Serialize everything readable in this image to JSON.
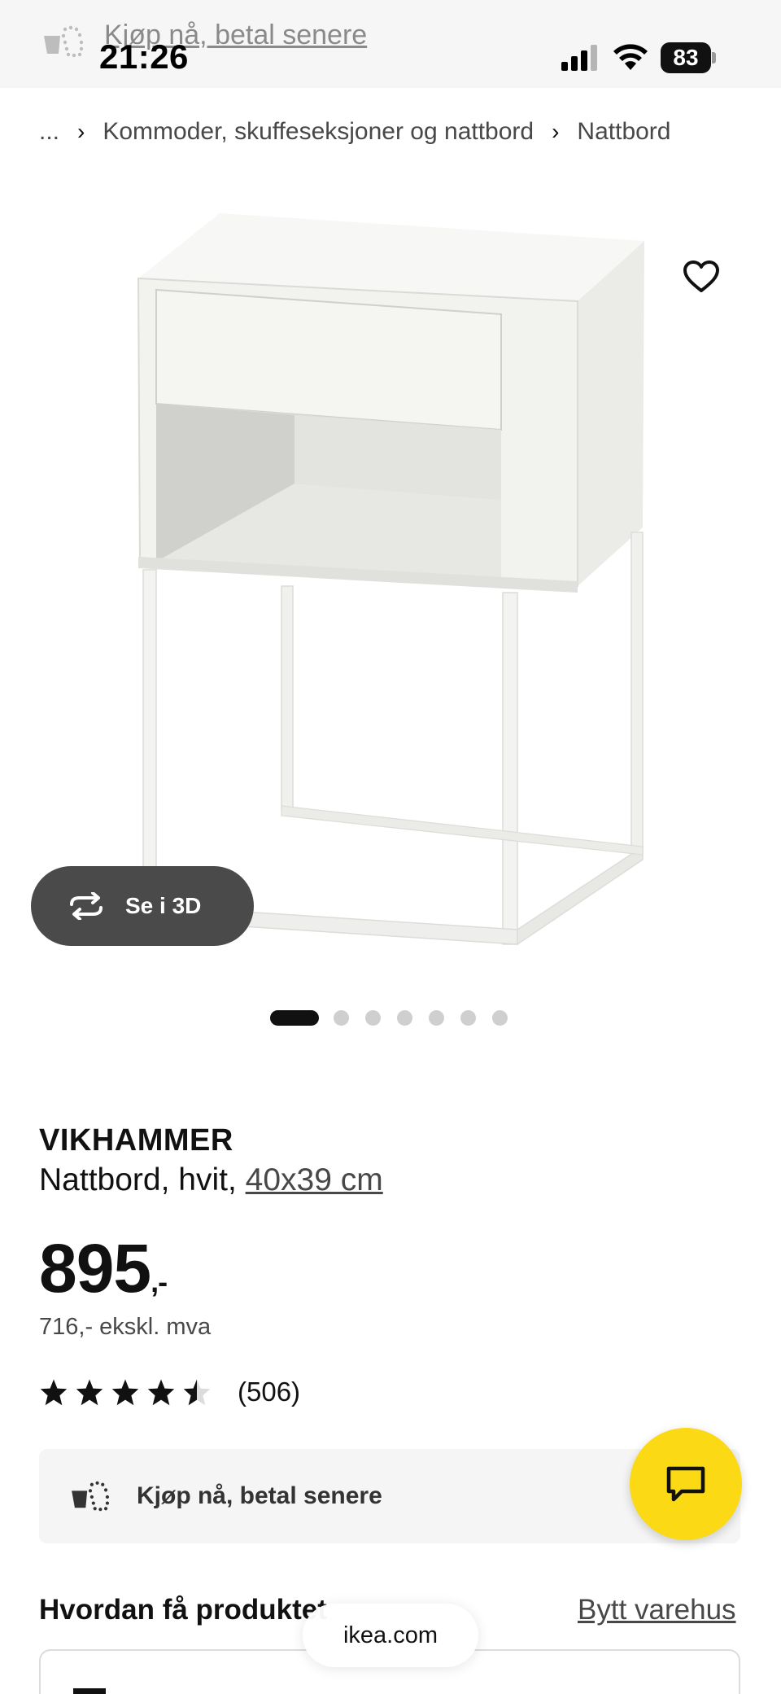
{
  "status_bar": {
    "promo_text": "Kjøp nå, betal senere",
    "time": "21:26",
    "battery": "83"
  },
  "breadcrumb": {
    "ellipsis": "...",
    "items": [
      "Kommoder, skuffeseksjoner og nattbord",
      "Nattbord"
    ]
  },
  "gallery": {
    "see_3d_label": "Se i 3D",
    "image_count": 7,
    "active_index": 0
  },
  "product": {
    "name": "VIKHAMMER",
    "description": "Nattbord, hvit, ",
    "size": "40x39 cm",
    "price": "895",
    "price_suffix": ",-",
    "price_ex_vat": "716,- ekskl. mva",
    "rating_value": 4.5,
    "rating_max": 5,
    "review_count": "(506)"
  },
  "pay_later": {
    "label": "Kjøp nå, betal senere"
  },
  "delivery": {
    "heading": "Hvordan få produktet",
    "change_store": "Bytt varehus"
  },
  "browser": {
    "url": "ikea.com"
  },
  "colors": {
    "accent_yellow": "#fbd914",
    "pill_dark": "#4a4a4a",
    "text": "#111111"
  },
  "icons": {
    "promo": "klarna-bag-icon",
    "signal": "cellular-signal-icon",
    "wifi": "wifi-icon",
    "favorite": "heart-icon",
    "rotate": "rotate-3d-icon",
    "chat": "chat-bubble-icon"
  }
}
